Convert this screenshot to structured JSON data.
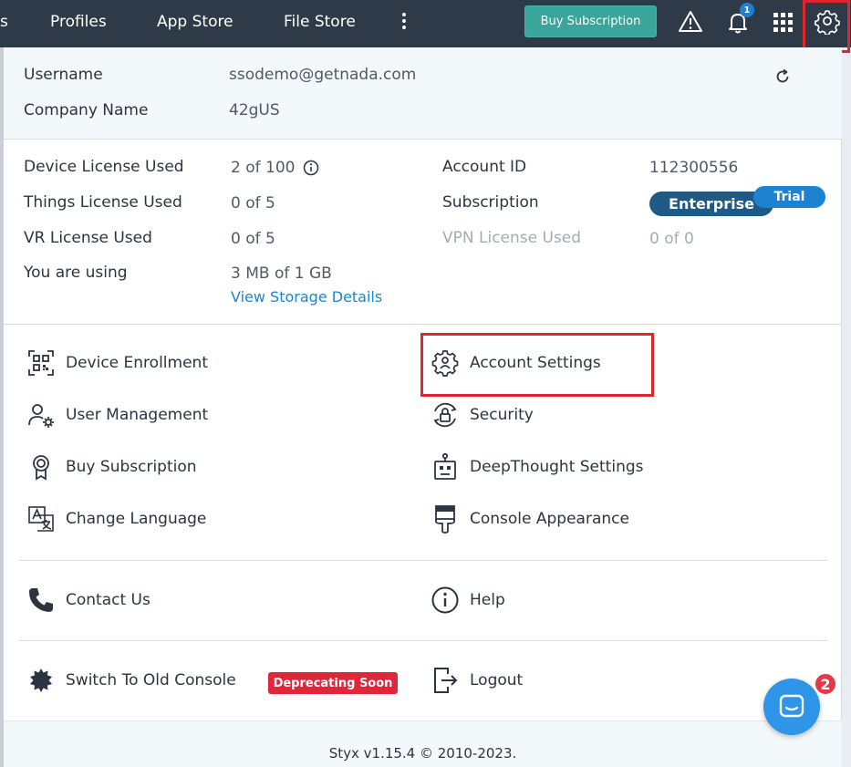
{
  "nav": {
    "items": [
      "s",
      "Profiles",
      "App Store",
      "File Store"
    ],
    "buy_label": "Buy Subscription",
    "notification_count": "1"
  },
  "profile": {
    "username_label": "Username",
    "username_value": "ssodemo@getnada.com",
    "company_label": "Company Name",
    "company_value": "42gUS"
  },
  "licenses": {
    "device_label": "Device License Used",
    "device_value": "2 of 100",
    "things_label": "Things License Used",
    "things_value": "0 of 5",
    "vr_label": "VR License Used",
    "vr_value": "0 of 5",
    "storage_label": "You are using",
    "storage_value": "3 MB of 1 GB",
    "storage_link": "View Storage Details",
    "account_label": "Account ID",
    "account_value": "112300556",
    "subscription_label": "Subscription",
    "subscription_value": "Enterprise",
    "trial_label": "Trial",
    "vpn_label": "VPN License Used",
    "vpn_value": "0 of 0"
  },
  "menu": {
    "left": [
      "Device Enrollment",
      "User Management",
      "Buy Subscription",
      "Change Language"
    ],
    "right": [
      "Account Settings",
      "Security",
      "DeepThought Settings",
      "Console Appearance"
    ],
    "contact": "Contact Us",
    "help": "Help",
    "old_console": "Switch To Old Console",
    "deprecating": "Deprecating Soon",
    "logout": "Logout"
  },
  "footer": {
    "version": "Styx v1.15.4 © 2010-2023."
  },
  "chat": {
    "badge": "2"
  },
  "colors": {
    "nav_bg": "#2f3a48",
    "accent": "#3aa59a",
    "highlight": "#e0262c",
    "link": "#1f84c9"
  }
}
